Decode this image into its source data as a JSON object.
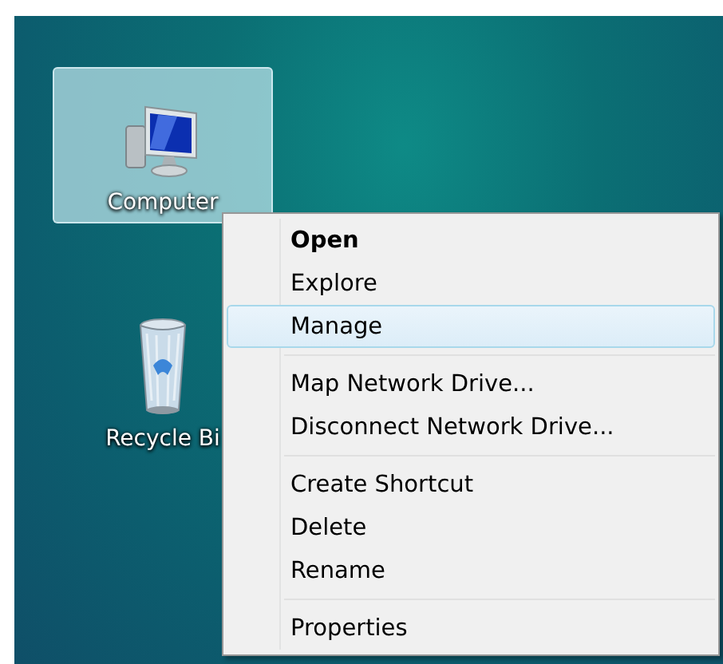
{
  "desktop": {
    "icons": [
      {
        "kind": "computer",
        "label": "Computer",
        "selected": true
      },
      {
        "kind": "recycle-bin",
        "label": "Recycle Bi",
        "selected": false
      }
    ],
    "context_menu": {
      "groups": [
        [
          {
            "label": "Open",
            "default": true,
            "selected": false
          },
          {
            "label": "Explore",
            "default": false,
            "selected": false
          },
          {
            "label": "Manage",
            "default": false,
            "selected": true
          }
        ],
        [
          {
            "label": "Map Network Drive...",
            "default": false,
            "selected": false
          },
          {
            "label": "Disconnect Network Drive...",
            "default": false,
            "selected": false
          }
        ],
        [
          {
            "label": "Create Shortcut",
            "default": false,
            "selected": false
          },
          {
            "label": "Delete",
            "default": false,
            "selected": false
          },
          {
            "label": "Rename",
            "default": false,
            "selected": false
          }
        ],
        [
          {
            "label": "Properties",
            "default": false,
            "selected": false
          }
        ]
      ]
    }
  }
}
